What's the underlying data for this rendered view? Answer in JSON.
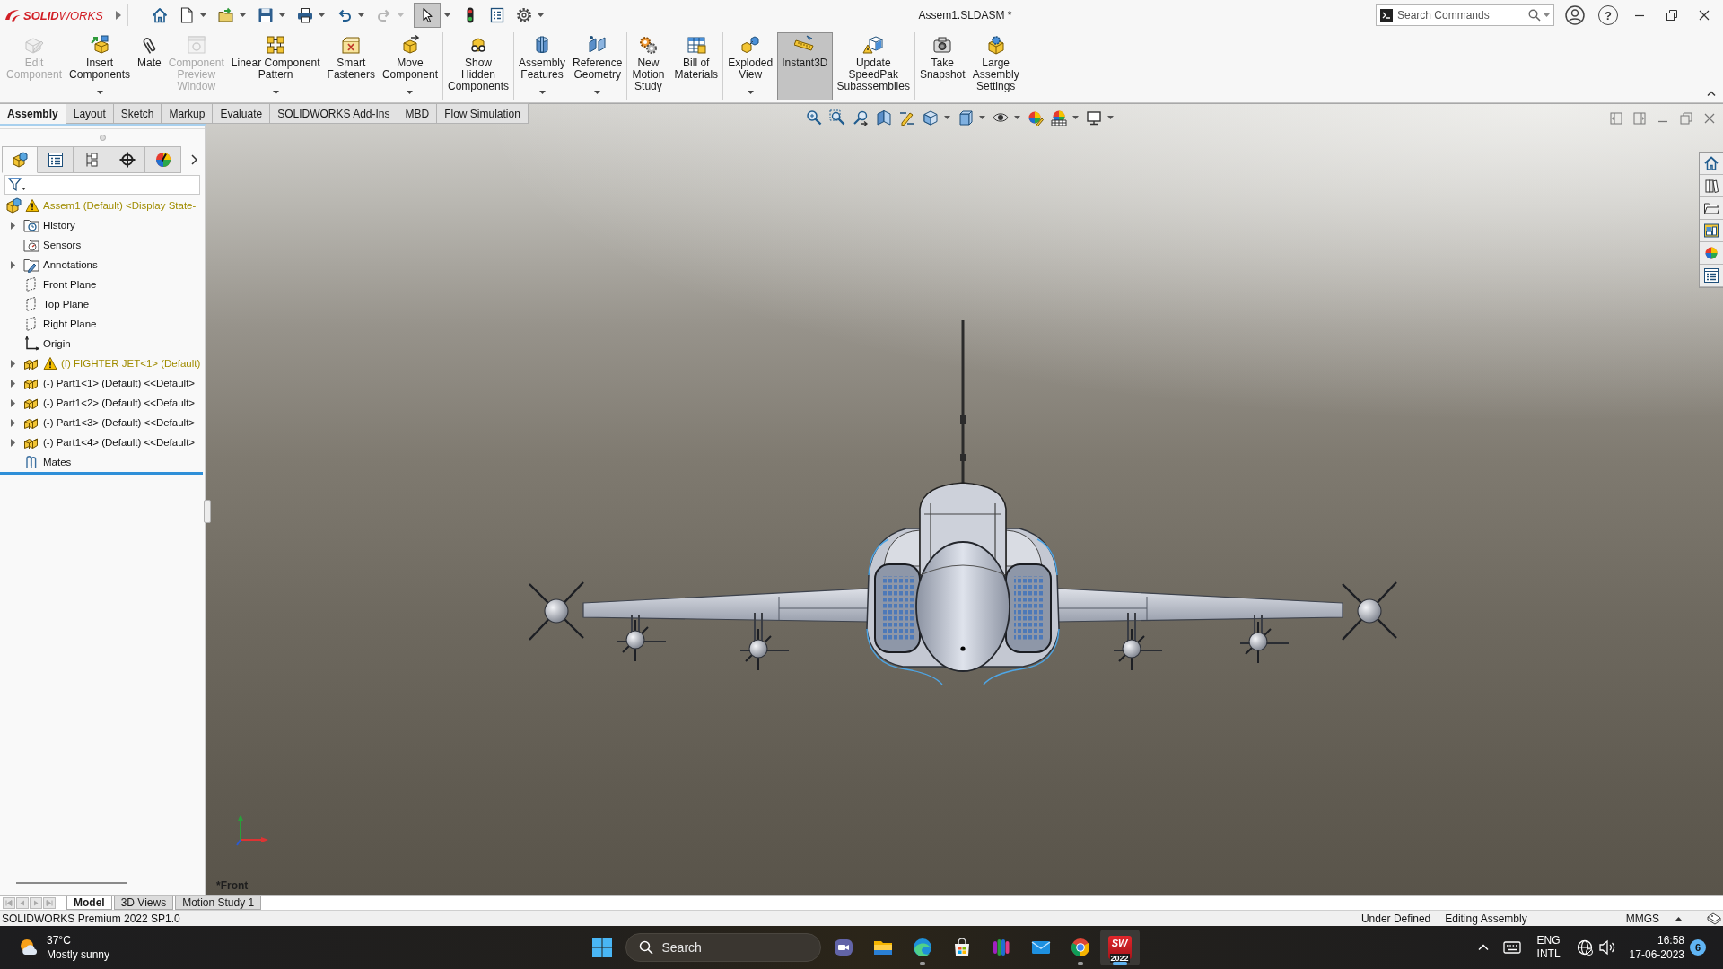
{
  "title_bar": {
    "logo": "**SOLID**WORKS",
    "document_title": "Assem1.SLDASM *",
    "search": {
      "placeholder": "Search Commands"
    },
    "help": "?"
  },
  "quick_access": [
    {
      "kind": "home",
      "dropdown": false,
      "disabled": false,
      "pressed": false
    },
    {
      "kind": "new",
      "dropdown": true,
      "disabled": false,
      "pressed": false
    },
    {
      "kind": "open",
      "dropdown": true,
      "disabled": false,
      "pressed": false
    },
    {
      "kind": "save",
      "dropdown": true,
      "disabled": false,
      "pressed": false
    },
    {
      "kind": "print",
      "dropdown": true,
      "disabled": false,
      "pressed": false
    },
    {
      "kind": "undo",
      "dropdown": true,
      "disabled": false,
      "pressed": false
    },
    {
      "kind": "redo",
      "dropdown": true,
      "disabled": true,
      "pressed": false
    },
    {
      "kind": "select",
      "dropdown": true,
      "disabled": false,
      "pressed": true
    },
    {
      "kind": "rebuild",
      "dropdown": false,
      "disabled": false,
      "pressed": false
    },
    {
      "kind": "file-properties",
      "dropdown": false,
      "disabled": false,
      "pressed": false
    },
    {
      "kind": "options",
      "dropdown": true,
      "disabled": false,
      "pressed": false
    }
  ],
  "command_manager": {
    "groups": [
      {
        "buttons": [
          {
            "kind": "edit-component",
            "label": "Edit\nComponent",
            "disabled": true,
            "selected": false,
            "dropdown": false
          },
          {
            "kind": "insert-components",
            "label": "Insert\nComponents",
            "disabled": false,
            "selected": false,
            "dropdown": true
          },
          {
            "kind": "mate",
            "label": "Mate",
            "disabled": false,
            "selected": false,
            "dropdown": false
          },
          {
            "kind": "component-preview",
            "label": "Component\nPreview\nWindow",
            "disabled": true,
            "selected": false,
            "dropdown": false
          },
          {
            "kind": "linear-pattern",
            "label": "Linear Component\nPattern",
            "disabled": false,
            "selected": false,
            "dropdown": true
          },
          {
            "kind": "smart-fasteners",
            "label": "Smart\nFasteners",
            "disabled": false,
            "selected": false,
            "dropdown": false
          },
          {
            "kind": "move-component",
            "label": "Move\nComponent",
            "disabled": false,
            "selected": false,
            "dropdown": true
          }
        ]
      },
      {
        "buttons": [
          {
            "kind": "show-hidden",
            "label": "Show\nHidden\nComponents",
            "disabled": false,
            "selected": false,
            "dropdown": false
          }
        ]
      },
      {
        "buttons": [
          {
            "kind": "assembly-features",
            "label": "Assembly\nFeatures",
            "disabled": false,
            "selected": false,
            "dropdown": true
          },
          {
            "kind": "reference-geometry",
            "label": "Reference\nGeometry",
            "disabled": false,
            "selected": false,
            "dropdown": true
          }
        ]
      },
      {
        "buttons": [
          {
            "kind": "motion-study",
            "label": "New\nMotion\nStudy",
            "disabled": false,
            "selected": false,
            "dropdown": false
          }
        ]
      },
      {
        "buttons": [
          {
            "kind": "bill-of-materials",
            "label": "Bill of\nMaterials",
            "disabled": false,
            "selected": false,
            "dropdown": false
          }
        ]
      },
      {
        "buttons": [
          {
            "kind": "exploded-view",
            "label": "Exploded\nView",
            "disabled": false,
            "selected": false,
            "dropdown": true
          },
          {
            "kind": "instant3d",
            "label": "Instant3D",
            "disabled": false,
            "selected": true,
            "dropdown": false
          },
          {
            "kind": "speedpak",
            "label": "Update\nSpeedPak\nSubassemblies",
            "disabled": false,
            "selected": false,
            "dropdown": false
          }
        ]
      },
      {
        "buttons": [
          {
            "kind": "snapshot",
            "label": "Take\nSnapshot",
            "disabled": false,
            "selected": false,
            "dropdown": false
          },
          {
            "kind": "large-assembly",
            "label": "Large\nAssembly\nSettings",
            "disabled": false,
            "selected": false,
            "dropdown": false
          }
        ]
      }
    ],
    "tabs": [
      {
        "label": "Assembly",
        "selected": true
      },
      {
        "label": "Layout",
        "selected": false
      },
      {
        "label": "Sketch",
        "selected": false
      },
      {
        "label": "Markup",
        "selected": false
      },
      {
        "label": "Evaluate",
        "selected": false
      },
      {
        "label": "SOLIDWORKS Add-Ins",
        "selected": false
      },
      {
        "label": "MBD",
        "selected": false
      },
      {
        "label": "Flow Simulation",
        "selected": false
      }
    ]
  },
  "feature_tree": {
    "panel_tabs": [
      {
        "kind": "feature-manager",
        "selected": true
      },
      {
        "kind": "property-manager",
        "selected": false
      },
      {
        "kind": "configuration-manager",
        "selected": false
      },
      {
        "kind": "dimxpert-manager",
        "selected": false
      },
      {
        "kind": "display-manager",
        "selected": false
      }
    ],
    "items": [
      {
        "kind": "assembly",
        "label": "Assem1 (Default) <Display State-",
        "warning": true,
        "children": [
          {
            "kind": "history",
            "label": "History",
            "warning": false,
            "expanded": false
          },
          {
            "kind": "sensors",
            "label": "Sensors",
            "warning": false
          },
          {
            "kind": "annotations",
            "label": "Annotations",
            "warning": false,
            "expanded": false
          },
          {
            "kind": "plane",
            "label": "Front Plane",
            "warning": false
          },
          {
            "kind": "plane",
            "label": "Top Plane",
            "warning": false
          },
          {
            "kind": "plane",
            "label": "Right Plane",
            "warning": false
          },
          {
            "kind": "origin",
            "label": "Origin",
            "warning": false
          },
          {
            "kind": "part",
            "label": "(f) FIGHTER JET<1> (Default)",
            "warning": true,
            "expanded": false
          },
          {
            "kind": "part",
            "label": "(-) Part1<1> (Default) <<Default>",
            "warning": false,
            "expanded": false
          },
          {
            "kind": "part",
            "label": "(-) Part1<2> (Default) <<Default>",
            "warning": false,
            "expanded": false
          },
          {
            "kind": "part",
            "label": "(-) Part1<3> (Default) <<Default>",
            "warning": false,
            "expanded": false
          },
          {
            "kind": "part",
            "label": "(-) Part1<4> (Default) <<Default>",
            "warning": false,
            "expanded": false
          },
          {
            "kind": "mates",
            "label": "Mates",
            "warning": false
          }
        ]
      }
    ]
  },
  "viewport": {
    "view_label": "*Front"
  },
  "bottom_tabs": [
    {
      "label": "Model",
      "selected": true
    },
    {
      "label": "3D Views",
      "selected": false
    },
    {
      "label": "Motion Study 1",
      "selected": false
    }
  ],
  "status_bar": {
    "product": "SOLIDWORKS Premium 2022 SP1.0",
    "sketch_state": "Under Defined",
    "mode": "Editing Assembly",
    "units": "MMGS"
  },
  "taskbar": {
    "weather": {
      "temperature": "37°C",
      "condition": "Mostly sunny"
    },
    "search": {
      "placeholder": "Search"
    },
    "apps": [
      {
        "kind": "teams",
        "running": false,
        "active": false
      },
      {
        "kind": "file-explorer",
        "running": false,
        "active": false
      },
      {
        "kind": "edge",
        "running": true,
        "active": false
      },
      {
        "kind": "store",
        "running": false,
        "active": false
      },
      {
        "kind": "bars-app",
        "running": false,
        "active": false
      },
      {
        "kind": "mail",
        "running": false,
        "active": false
      },
      {
        "kind": "chrome",
        "running": true,
        "active": false
      },
      {
        "kind": "solidworks",
        "running": true,
        "active": true,
        "icon_label": "SW",
        "version": "2022"
      }
    ],
    "tray": {
      "language": "ENG",
      "layout": "INTL",
      "time": "16:58",
      "date": "17-06-2023",
      "notifications": "6"
    }
  }
}
